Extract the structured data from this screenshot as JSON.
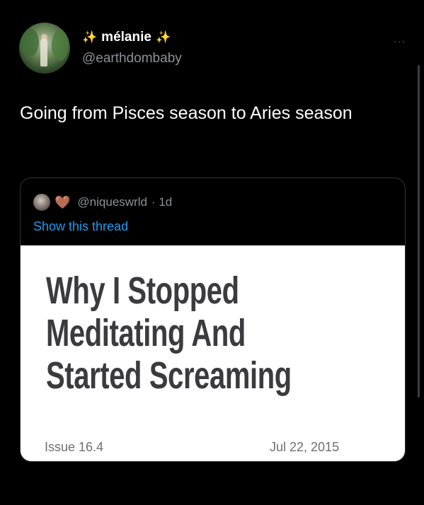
{
  "author": {
    "sparkle": "✨",
    "name": "mélanie",
    "handle": "@earthdombaby"
  },
  "more_label": "···",
  "tweet_text": "Going from Pisces season to Aries season",
  "quoted_tweet": {
    "heart_icon": "🤎",
    "handle": "@niqueswrld",
    "time": "· 1d",
    "show_thread": "Show this thread",
    "image": {
      "headline": "Why I Stopped Meditating And Started Screaming",
      "issue": "Issue 16.4",
      "date": "Jul 22, 2015"
    }
  }
}
